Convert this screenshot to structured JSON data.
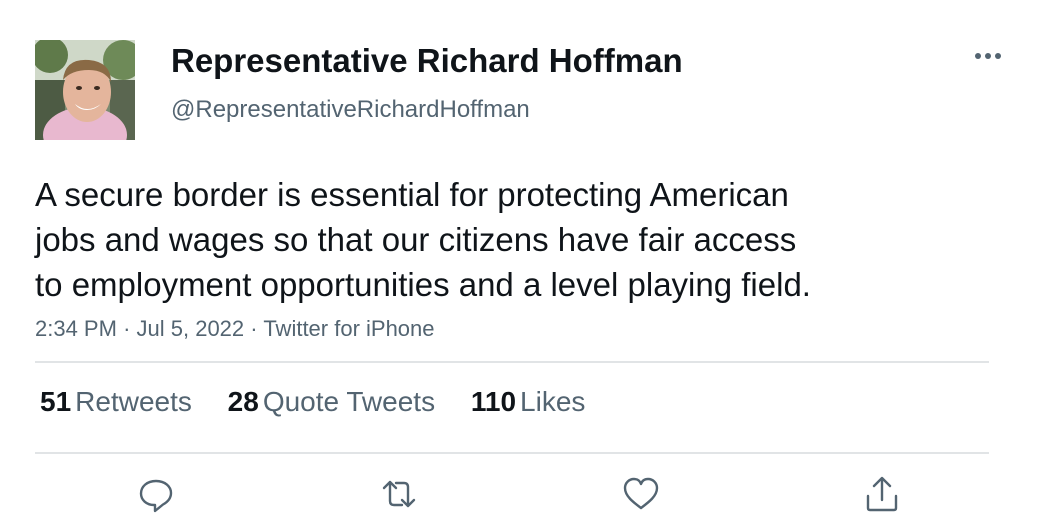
{
  "tweet": {
    "author_name": "Representative Richard Hoffman",
    "author_handle": "@RepresentativeRichardHoffman",
    "text_lines": [
      "A secure border is essential for protecting American",
      "jobs and wages so that our citizens have fair access",
      "to employment opportunities and a level playing field."
    ],
    "time": "2:34 PM",
    "date": "Jul 5, 2022",
    "source": "Twitter for iPhone",
    "separator": "·"
  },
  "stats": {
    "retweets_count": "51",
    "retweets_label": "Retweets",
    "quotes_count": "28",
    "quotes_label": "Quote Tweets",
    "likes_count": "110",
    "likes_label": "Likes"
  },
  "icons": {
    "more": "more-dots-icon",
    "reply": "reply-icon",
    "retweet": "retweet-icon",
    "like": "heart-icon",
    "share": "share-icon"
  },
  "colors": {
    "text_primary": "#0f1419",
    "text_secondary": "#536471",
    "divider": "#e1e4e6",
    "icon": "#536471"
  }
}
